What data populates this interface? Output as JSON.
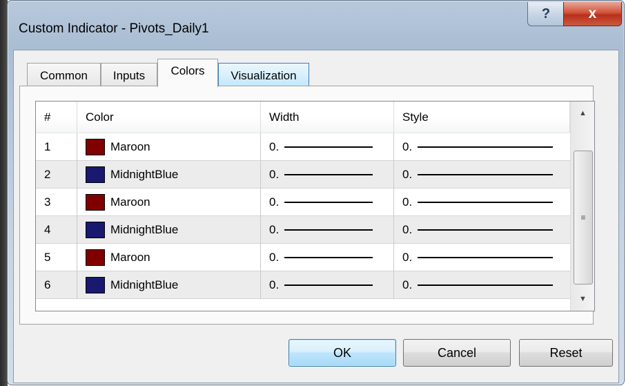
{
  "window": {
    "title": "Custom Indicator - Pivots_Daily1",
    "help_label": "?",
    "close_label": "x"
  },
  "tabs": [
    {
      "label": "Common",
      "state": "normal"
    },
    {
      "label": "Inputs",
      "state": "normal"
    },
    {
      "label": "Colors",
      "state": "selected"
    },
    {
      "label": "Visualization",
      "state": "hover"
    }
  ],
  "table": {
    "columns": [
      "#",
      "Color",
      "Width",
      "Style"
    ],
    "rows": [
      {
        "num": "1",
        "color_name": "Maroon",
        "swatch": "#800000",
        "width": "0.",
        "style": "0."
      },
      {
        "num": "2",
        "color_name": "MidnightBlue",
        "swatch": "#191970",
        "width": "0.",
        "style": "0."
      },
      {
        "num": "3",
        "color_name": "Maroon",
        "swatch": "#800000",
        "width": "0.",
        "style": "0."
      },
      {
        "num": "4",
        "color_name": "MidnightBlue",
        "swatch": "#191970",
        "width": "0.",
        "style": "0."
      },
      {
        "num": "5",
        "color_name": "Maroon",
        "swatch": "#800000",
        "width": "0.",
        "style": "0."
      },
      {
        "num": "6",
        "color_name": "MidnightBlue",
        "swatch": "#191970",
        "width": "0.",
        "style": "0."
      }
    ]
  },
  "scrollbar": {
    "up": "▲",
    "down": "▼",
    "grip": "≡"
  },
  "buttons": {
    "ok": "OK",
    "cancel": "Cancel",
    "reset": "Reset"
  }
}
